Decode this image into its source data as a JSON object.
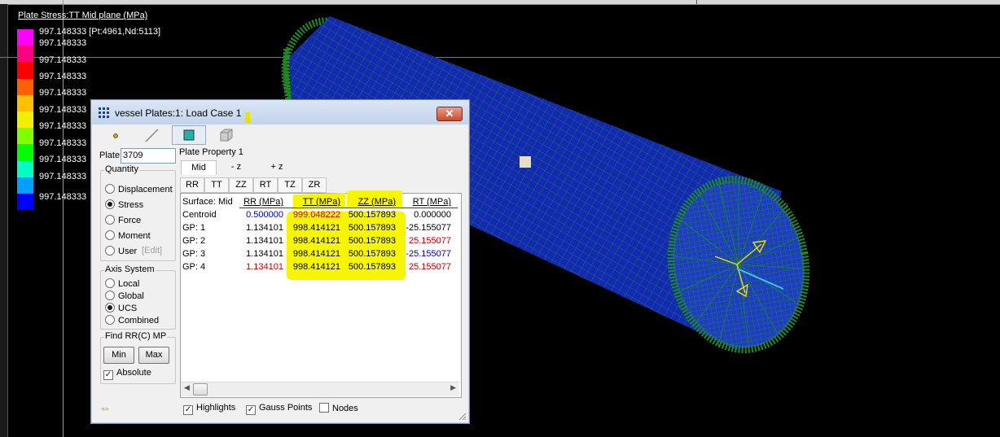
{
  "legend": {
    "title": "Plate Stress:TT Mid plane  (MPa)",
    "labels": [
      "997.148333 [Pt:4961,Nd:5113]",
      "997.148333",
      "997.148333",
      "997.148333",
      "997.148333",
      "997.148333",
      "997.148333",
      "997.148333",
      "997.148333",
      "997.148333",
      "997.148333"
    ],
    "colors": [
      "#ff00ff",
      "#ff0080",
      "#ff0000",
      "#ff6000",
      "#ffc000",
      "#f0f000",
      "#80ff00",
      "#00ff00",
      "#00ffc0",
      "#00a0ff",
      "#0000ff"
    ]
  },
  "dialog": {
    "title": "vessel Plates:1: Load Case 1",
    "close_label": "✕",
    "toolbar": [
      "node-tool-icon",
      "line-tool-icon",
      "plate-tool-icon",
      "brick-tool-icon"
    ],
    "plate_label": "Plate",
    "plate_value": "3709",
    "quantity": {
      "title": "Quantity",
      "options": [
        "Displacement",
        "Stress",
        "Force",
        "Moment",
        "User"
      ],
      "selected": "Stress",
      "edit_label": "[Edit]"
    },
    "axis_system": {
      "title": "Axis System",
      "options": [
        "Local",
        "Global",
        "UCS",
        "Combined"
      ],
      "selected": "UCS"
    },
    "find": {
      "title": "Find RR(C) MP",
      "min_label": "Min",
      "max_label": "Max",
      "absolute_label": "Absolute",
      "absolute_checked": true
    },
    "plate_property": "Plate Property 1",
    "surface_tabs": [
      "Mid",
      "- z",
      "+ z"
    ],
    "surface_selected": "Mid",
    "component_tabs": [
      "RR",
      "TT",
      "ZZ",
      "RT",
      "TZ",
      "ZR"
    ],
    "table": {
      "columns": [
        "Surface: Mid",
        "RR (MPa)",
        "TT (MPa)",
        "ZZ (MPa)",
        "RT (MPa)"
      ],
      "rows": [
        [
          "Centroid",
          "0.500000",
          "999.048222",
          "500.157893",
          "0.000000"
        ],
        [
          "GP: 1",
          "1.134101",
          "998.414121",
          "500.157893",
          "-25.155077"
        ],
        [
          "GP: 2",
          "1.134101",
          "998.414121",
          "500.157893",
          "25.155077"
        ],
        [
          "GP: 3",
          "1.134101",
          "998.414121",
          "500.157893",
          "-25.155077"
        ],
        [
          "GP: 4",
          "1.134101",
          "998.414121",
          "500.157893",
          "25.155077"
        ]
      ]
    },
    "bottom": {
      "highlights_label": "Highlights",
      "highlights_checked": true,
      "gauss_label": "Gauss Points",
      "gauss_checked": true,
      "nodes_label": "Nodes",
      "nodes_checked": false
    },
    "colors": {
      "min_value": "#0000cc",
      "max_value": "#cc0000",
      "highlight": "#f6f600",
      "mesh_blue": "#1428b4",
      "mesh_green": "#1e8c1e"
    }
  }
}
